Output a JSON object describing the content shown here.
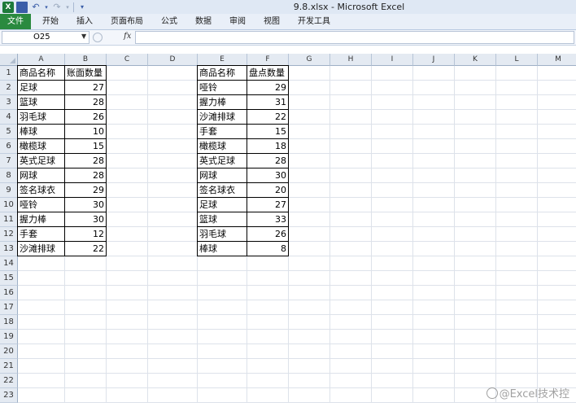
{
  "window": {
    "title": "9.8.xlsx - Microsoft Excel"
  },
  "qat": {
    "logo_text": "X"
  },
  "ribbon": {
    "tabs": [
      "文件",
      "开始",
      "插入",
      "页面布局",
      "公式",
      "数据",
      "审阅",
      "视图",
      "开发工具"
    ]
  },
  "formula_bar": {
    "name_box": "O25",
    "fx_label": "fx",
    "formula": ""
  },
  "columns": [
    "A",
    "B",
    "C",
    "D",
    "E",
    "F",
    "G",
    "H",
    "I",
    "J",
    "K",
    "L",
    "M"
  ],
  "rows": [
    "1",
    "2",
    "3",
    "4",
    "5",
    "6",
    "7",
    "8",
    "9",
    "10",
    "11",
    "12",
    "13",
    "14",
    "15",
    "16",
    "17",
    "18",
    "19",
    "20",
    "21",
    "22",
    "23"
  ],
  "table1": {
    "headers": [
      "商品名称",
      "账面数量"
    ],
    "rows": [
      [
        "足球",
        "27"
      ],
      [
        "篮球",
        "28"
      ],
      [
        "羽毛球",
        "26"
      ],
      [
        "棒球",
        "10"
      ],
      [
        "橄榄球",
        "15"
      ],
      [
        "英式足球",
        "28"
      ],
      [
        "网球",
        "28"
      ],
      [
        "签名球衣",
        "29"
      ],
      [
        "哑铃",
        "30"
      ],
      [
        "握力棒",
        "30"
      ],
      [
        "手套",
        "12"
      ],
      [
        "沙滩排球",
        "22"
      ]
    ]
  },
  "table2": {
    "headers": [
      "商品名称",
      "盘点数量"
    ],
    "rows": [
      [
        "哑铃",
        "29"
      ],
      [
        "握力棒",
        "31"
      ],
      [
        "沙滩排球",
        "22"
      ],
      [
        "手套",
        "15"
      ],
      [
        "橄榄球",
        "18"
      ],
      [
        "英式足球",
        "28"
      ],
      [
        "网球",
        "30"
      ],
      [
        "签名球衣",
        "20"
      ],
      [
        "足球",
        "27"
      ],
      [
        "篮球",
        "33"
      ],
      [
        "羽毛球",
        "26"
      ],
      [
        "棒球",
        "8"
      ]
    ]
  },
  "watermark": {
    "text": "@Excel技术控"
  }
}
